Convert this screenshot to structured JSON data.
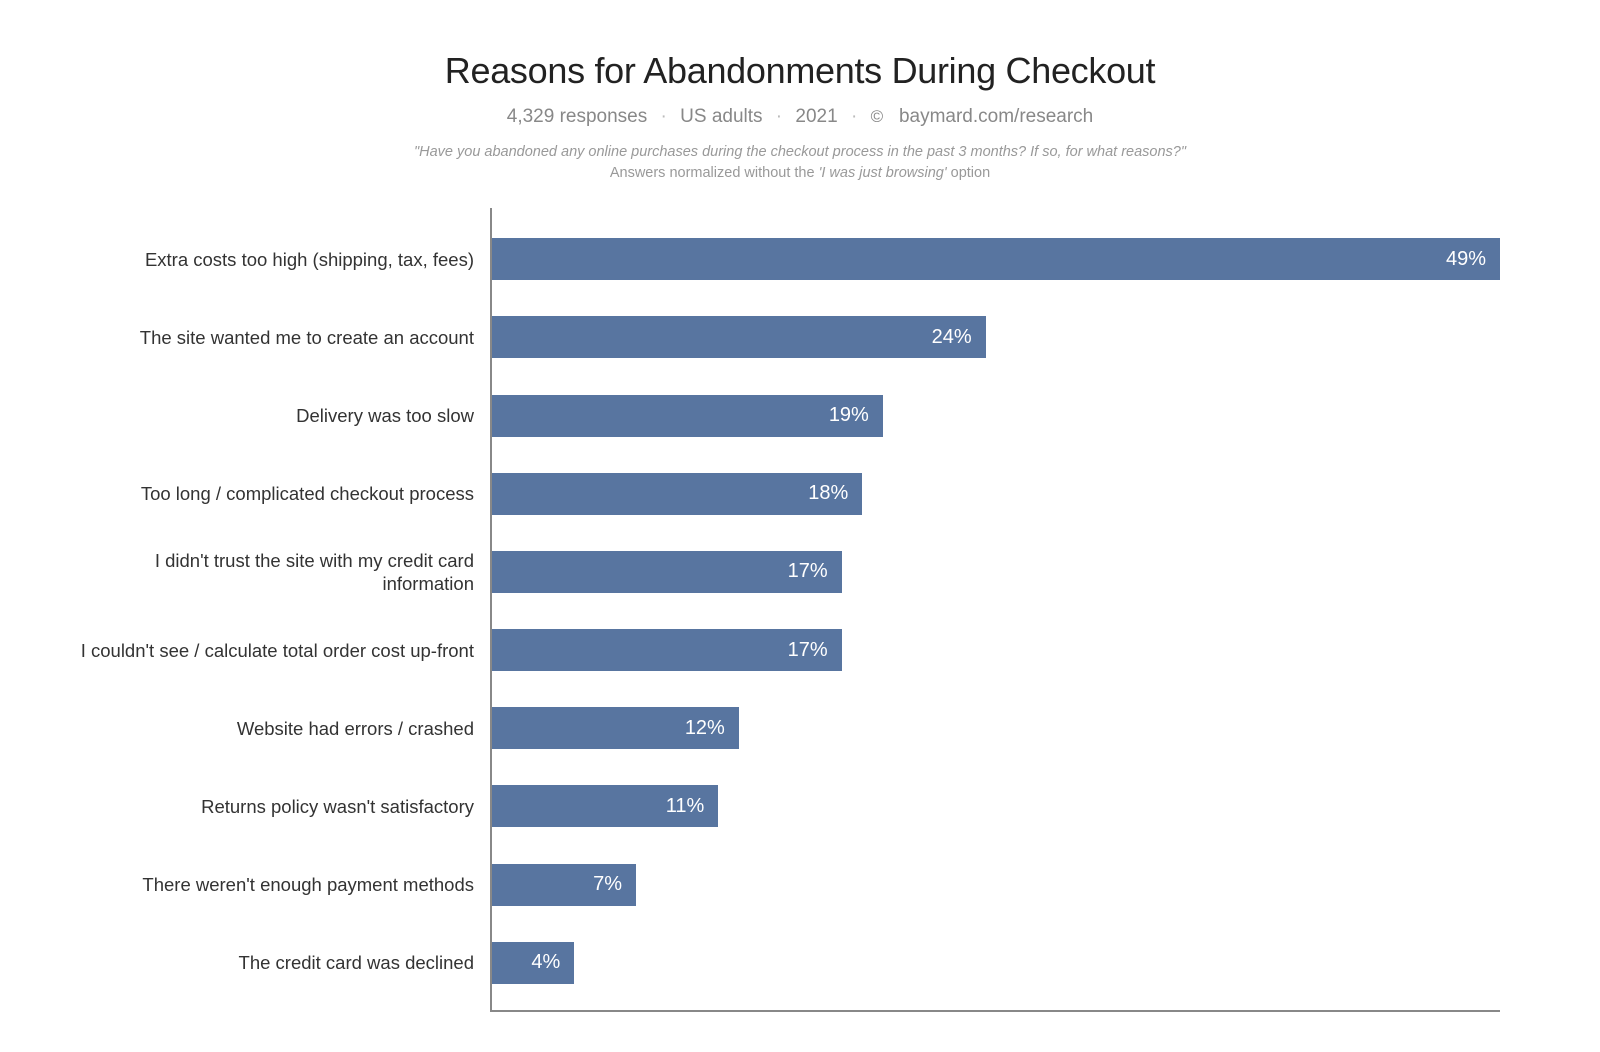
{
  "chart_data": {
    "type": "bar",
    "orientation": "horizontal",
    "title": "Reasons for Abandonments During Checkout",
    "subtitle_parts": {
      "responses": "4,329 responses",
      "audience": "US adults",
      "year": "2021",
      "copyright_symbol": "©",
      "source": "baymard.com/research"
    },
    "note_line1": "\"Have you abandoned any online purchases during the checkout process in the past 3 months? If so, for what reasons?\"",
    "note_line2_prefix": "Answers normalized without the ",
    "note_line2_italic": "'I was just browsing'",
    "note_line2_suffix": " option",
    "xlim": [
      0,
      49
    ],
    "bar_color": "#5875A0",
    "categories": [
      "Extra costs too high (shipping, tax, fees)",
      "The site wanted me to create an account",
      "Delivery was too slow",
      "Too long / complicated checkout process",
      "I didn't trust the site with my credit card information",
      "I couldn't see / calculate total order cost up-front",
      "Website had errors / crashed",
      "Returns policy wasn't satisfactory",
      "There weren't enough payment methods",
      "The credit card was declined"
    ],
    "values": [
      49,
      24,
      19,
      18,
      17,
      17,
      12,
      11,
      7,
      4
    ],
    "value_labels": [
      "49%",
      "24%",
      "19%",
      "18%",
      "17%",
      "17%",
      "12%",
      "11%",
      "7%",
      "4%"
    ]
  }
}
